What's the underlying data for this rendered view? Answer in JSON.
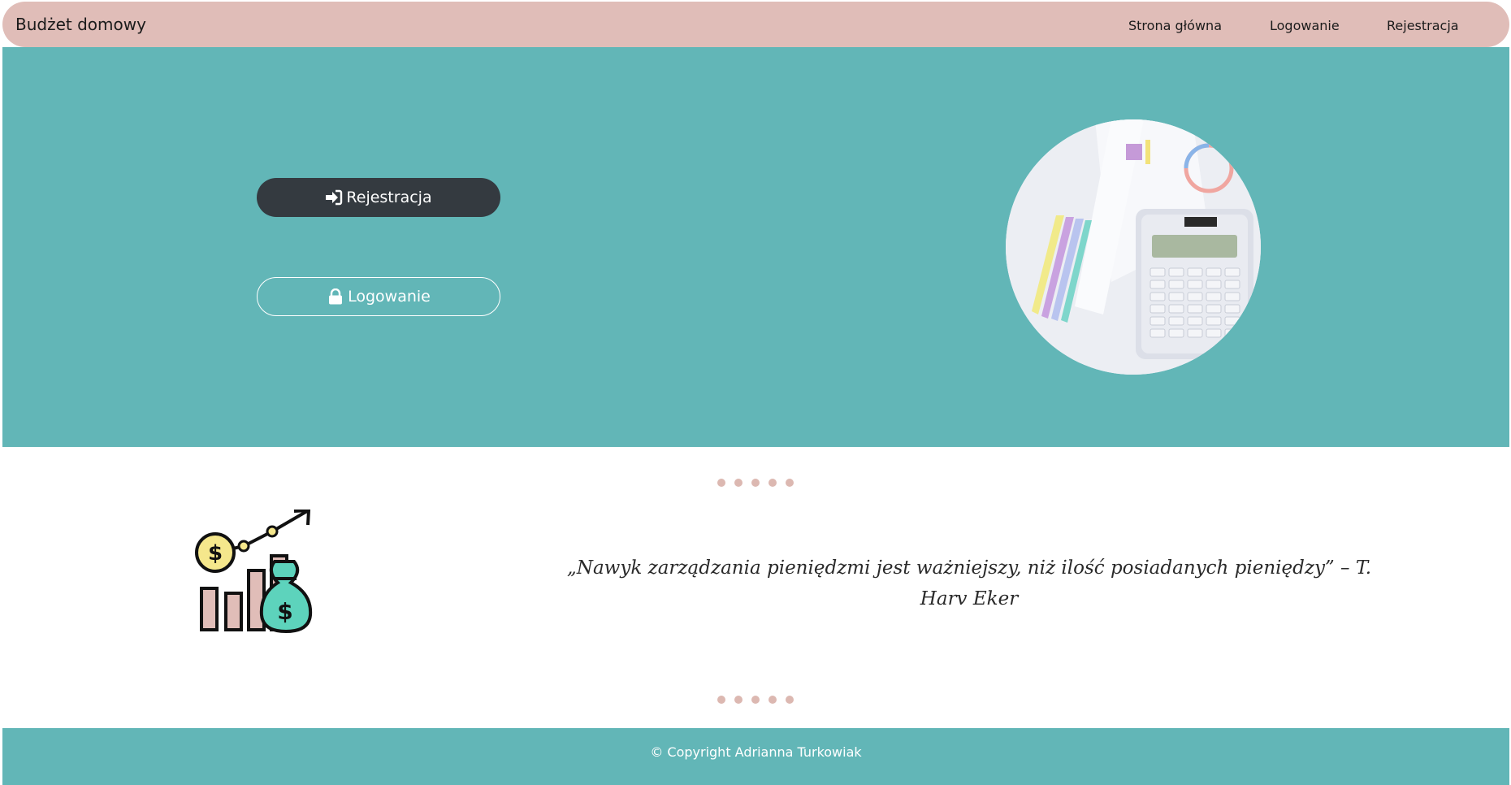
{
  "navbar": {
    "brand": "Budżet domowy",
    "links": [
      "Strona główna",
      "Logowanie",
      "Rejestracja"
    ]
  },
  "hero": {
    "register_button": "Rejestracja",
    "login_button": "Logowanie",
    "register_icon": "sign-in-icon",
    "login_icon": "lock-icon"
  },
  "quote": {
    "text": "„Nawyk zarządzania pieniędzmi jest ważniejszy, niż ilość posiadanych pieniędzy” – T. Harv Eker"
  },
  "footer": {
    "copyright": "© Copyright Adrianna Turkowiak"
  },
  "colors": {
    "navbar": "#e0bdb8",
    "teal": "#62b6b7",
    "dark_button": "#343a40",
    "dots": "#dcb8b1"
  }
}
